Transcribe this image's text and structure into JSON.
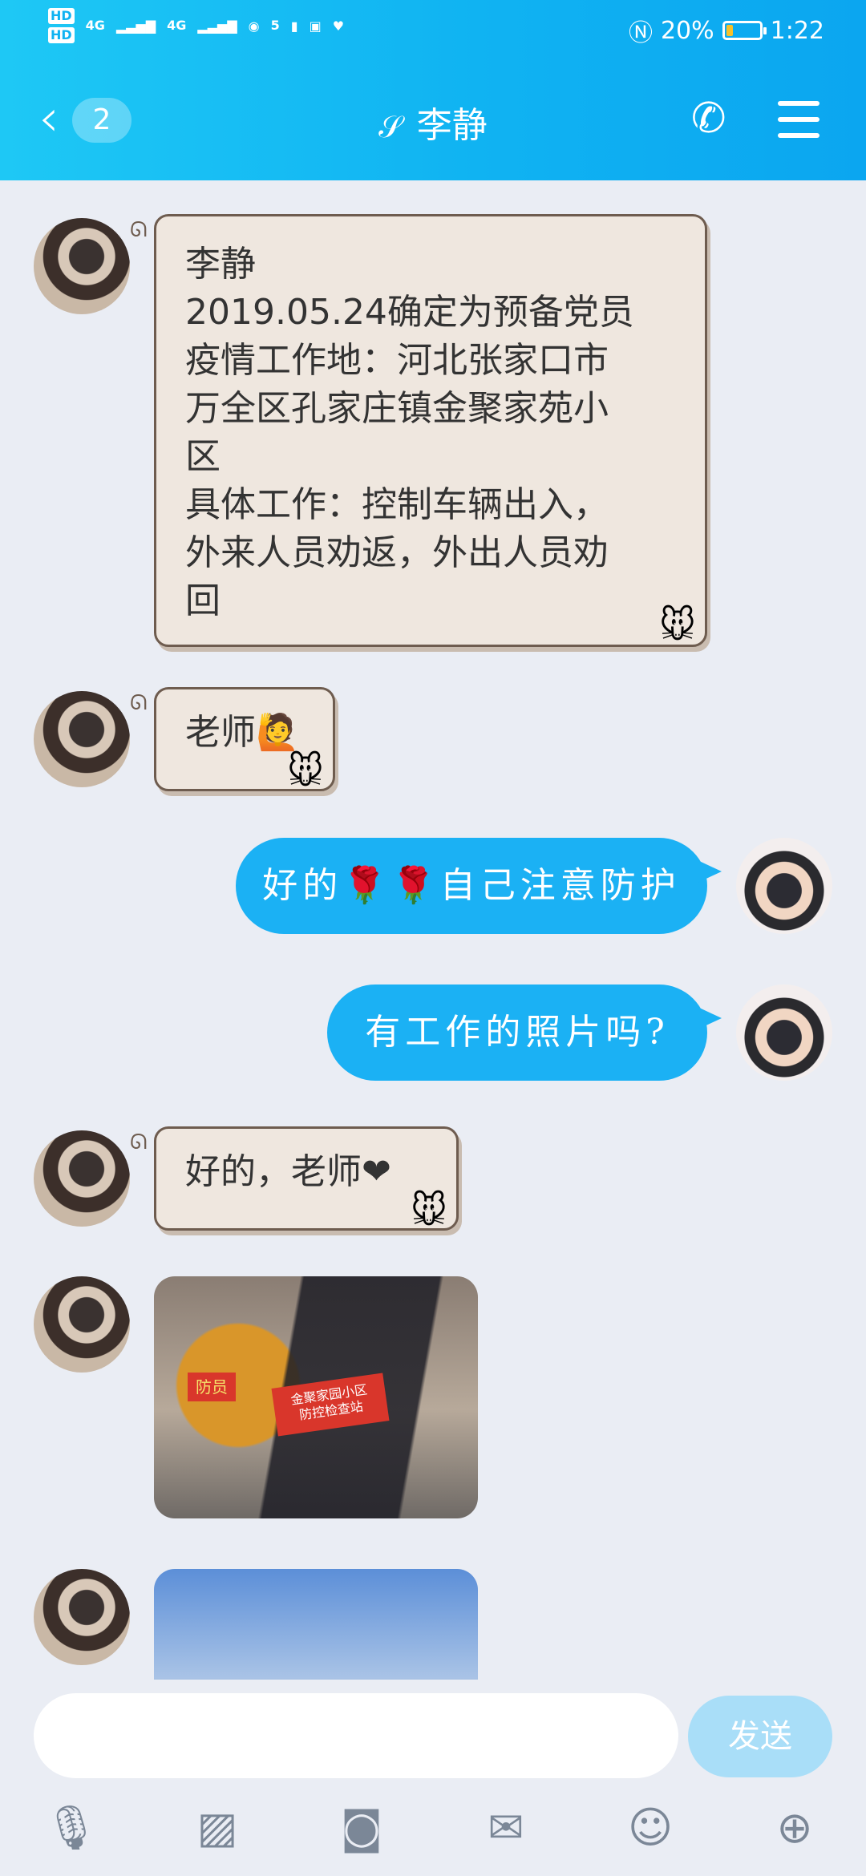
{
  "status_bar": {
    "hd1": "HD",
    "hd2": "HD",
    "net1": "4G",
    "net2": "4G",
    "wifi_badge": "5",
    "battery_percent": "20%",
    "battery_level": 0.2,
    "time": "1:22"
  },
  "header": {
    "unread_count": "2",
    "contact_name": "李静"
  },
  "messages": [
    {
      "side": "left",
      "text": "李静\n2019.05.24确定为预备党员\n疫情工作地：河北张家口市\n万全区孔家庄镇金聚家苑小\n区\n具体工作：控制车辆出入，\n外来人员劝返，外出人员劝\n回"
    },
    {
      "side": "left",
      "text": "老师🙋"
    },
    {
      "side": "right",
      "text": "好的🌹🌹自己注意防护"
    },
    {
      "side": "right",
      "text": "有工作的照片吗?"
    },
    {
      "side": "left",
      "text": "好的，老师❤"
    }
  ],
  "photo1": {
    "sign_text": "金聚家园小区\n防控检查站",
    "armband_text": "防员"
  },
  "input": {
    "placeholder": "",
    "send_label": "发送"
  },
  "toolbar": [
    "mic-icon",
    "image-icon",
    "camera-icon",
    "red-packet-icon",
    "emoji-icon",
    "plus-icon"
  ]
}
